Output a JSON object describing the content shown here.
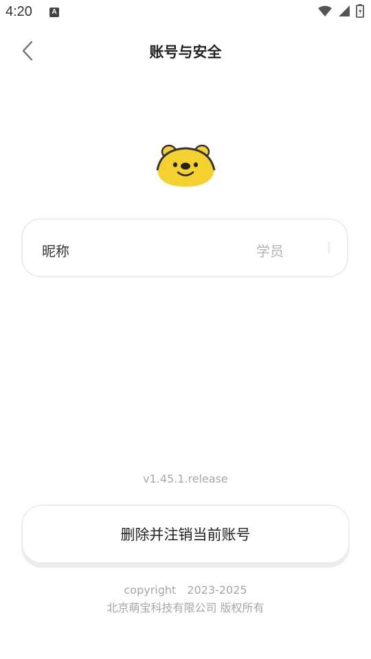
{
  "status_bar": {
    "time": "4:20",
    "notification_icon_label": "A",
    "icons": [
      "wifi-icon",
      "signal-icon",
      "battery-icon"
    ]
  },
  "header": {
    "title": "账号与安全",
    "back_icon": "chevron-left-icon"
  },
  "profile": {
    "mascot_icon": "bear-mascot-icon",
    "nickname_label": "昵称",
    "nickname_value": "学员"
  },
  "app": {
    "version": "v1.45.1.release"
  },
  "actions": {
    "delete_account_label": "删除并注销当前账号"
  },
  "footer": {
    "copyright": "copyright　2023-2025",
    "company": "北京萌宝科技有限公司 版权所有"
  },
  "colors": {
    "mascot_yellow": "#F5D130",
    "text_primary": "#222222",
    "text_muted": "#A8A8A8"
  }
}
